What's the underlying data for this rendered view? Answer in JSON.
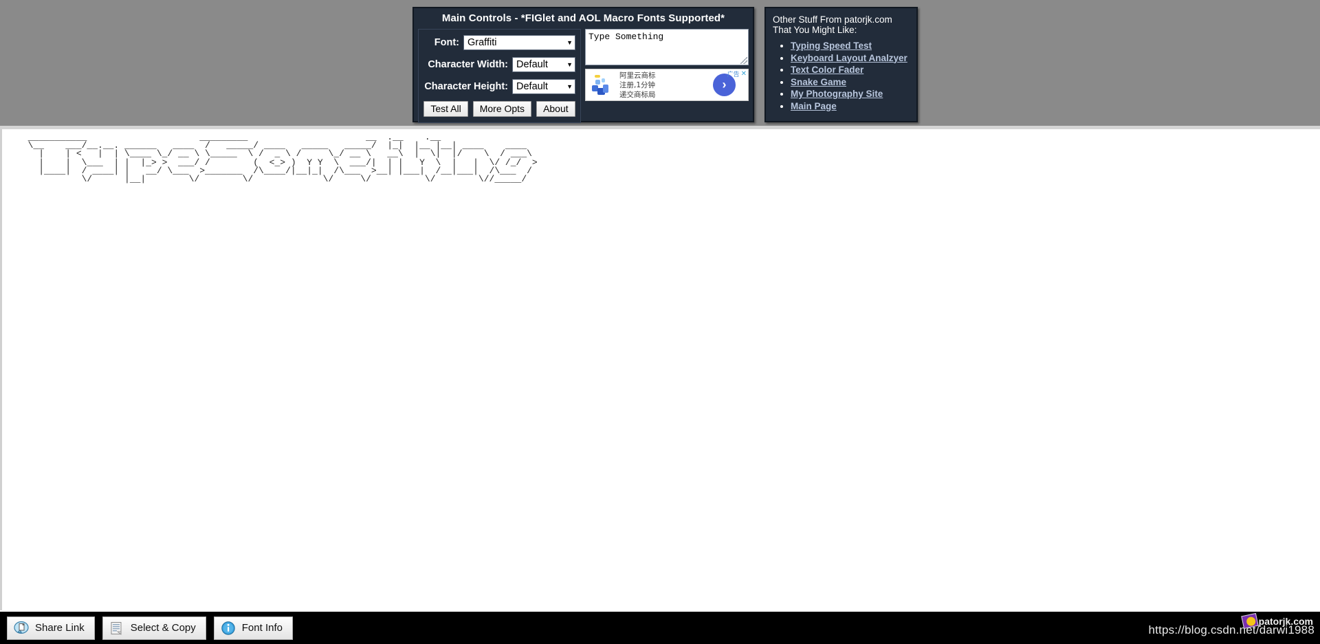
{
  "controls": {
    "title": "Main Controls - *FIGlet and AOL Macro Fonts Supported*",
    "font_label": "Font:",
    "font_value": "Graffiti",
    "char_width_label": "Character Width:",
    "char_width_value": "Default",
    "char_height_label": "Character Height:",
    "char_height_value": "Default",
    "buttons": [
      {
        "label": "Test All",
        "name": "test-all-button"
      },
      {
        "label": "More Opts",
        "name": "more-opts-button"
      },
      {
        "label": "About",
        "name": "about-button"
      }
    ],
    "caret": "▼"
  },
  "text_input": {
    "value": "Type Something",
    "placeholder": "Type Something"
  },
  "ad": {
    "line1": "阿里云商标",
    "line2": "注册,1分钟",
    "line3": "递交商标局",
    "cta": "›",
    "flag_label": "广告",
    "close": "✕"
  },
  "other_stuff": {
    "title_line1": "Other Stuff From patorjk.com",
    "title_line2": "That You Might Like:",
    "links": [
      "Typing Speed Test",
      "Keyboard Layout Analzyer",
      "Text Color Fader",
      "Snake Game",
      "My Photography Site",
      "Main Page"
    ]
  },
  "ascii_art": {
    "font": "Graffiti",
    "text": "Type Something",
    "content": "  ___________                     _________                      __  .__    .__                \n  \\__    ___/__.__. ______   ____  /   _____/ ____   _____   _____/  |_|  |__ |__| ____    ____ \n    |    | <   |  | \\____ \\_/ __ \\ \\_____  \\ /  _ \\ /     \\_/ __ \\   __\\  |  \\|  |/    \\  / ___\\\n    |    |  \\___  | |  |_> >  ___/ /        (  <_> )  Y Y  \\  ___/|  | |   Y  \\  |   |  \\/ /_/  >\n    |____|  / ____| |   __/ \\___  >_______  /\\____/|__|_|  /\\___  >__| |___|  /__|___|  /\\___  / \n            \\/      |__|        \\/        \\/             \\/     \\/          \\/        \\//_____/  "
  },
  "bottom_bar": {
    "buttons": [
      {
        "label": "Share Link",
        "icon": "share-link-icon"
      },
      {
        "label": "Select & Copy",
        "icon": "document-copy-icon"
      },
      {
        "label": "Font Info",
        "icon": "info-icon"
      }
    ]
  },
  "watermark": {
    "url": "https://blog.csdn.net/darwi1988",
    "site": "patorjk.com"
  },
  "colors": {
    "panel_bg": "#222c3a",
    "band_gray": "#8a8a8a",
    "link": "#b8c6dd",
    "ad_accent": "#4a63d8"
  }
}
